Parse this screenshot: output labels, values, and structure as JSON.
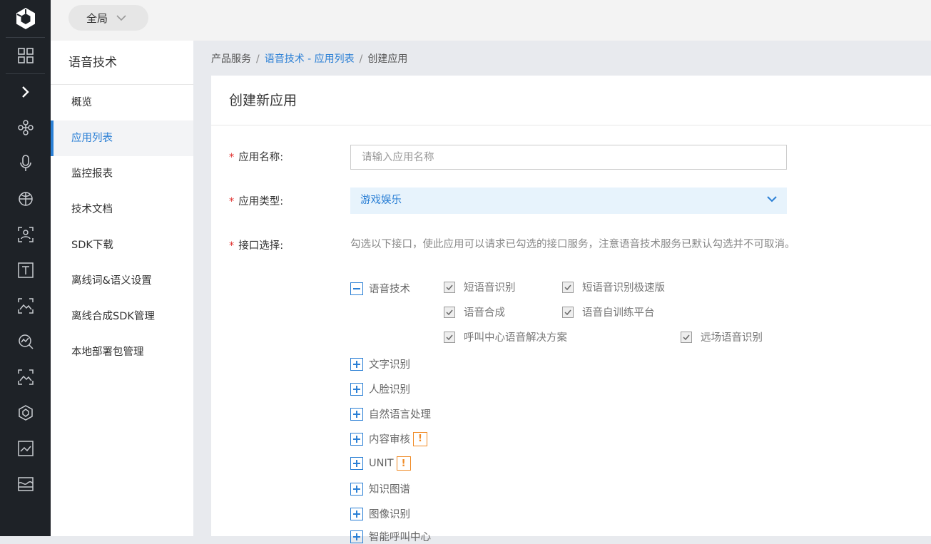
{
  "topbar": {
    "scope_label": "全局"
  },
  "rail_icons": [
    "grid-icon",
    "chevron-right-icon",
    "network-icon",
    "microphone-icon",
    "globe-icon",
    "face-scan-icon",
    "text-icon",
    "landscape-icon",
    "analytics-icon",
    "image-icon",
    "model-icon",
    "chart-icon",
    "map-icon"
  ],
  "sidebar": {
    "title": "语音技术",
    "items": [
      {
        "label": "概览"
      },
      {
        "label": "应用列表"
      },
      {
        "label": "监控报表"
      },
      {
        "label": "技术文档"
      },
      {
        "label": "SDK下载"
      },
      {
        "label": "离线词&语义设置"
      },
      {
        "label": "离线合成SDK管理"
      },
      {
        "label": "本地部署包管理"
      }
    ]
  },
  "breadcrumb": {
    "root": "产品服务",
    "sep": "/",
    "parent": "语音技术 - 应用列表",
    "current": "创建应用"
  },
  "form": {
    "title": "创建新应用",
    "required_mark": "*",
    "name_label": "应用名称:",
    "name_placeholder": "请输入应用名称",
    "type_label": "应用类型:",
    "type_value": "游戏娱乐",
    "api_label": "接口选择:",
    "api_hint": "勾选以下接口，使此应用可以请求已勾选的接口服务，注意语音技术服务已默认勾选并不可取消。",
    "expanded_group": {
      "name": "语音技术",
      "options": [
        "短语音识别",
        "短语音识别极速版",
        "语音合成",
        "语音自训练平台",
        "呼叫中心语音解决方案",
        "远场语音识别"
      ]
    },
    "collapsed_groups": [
      {
        "name": "文字识别",
        "warn": false
      },
      {
        "name": "人脸识别",
        "warn": false
      },
      {
        "name": "自然语言处理",
        "warn": false
      },
      {
        "name": "内容审核",
        "warn": true
      },
      {
        "name": "UNIT",
        "warn": true
      },
      {
        "name": "知识图谱",
        "warn": false
      },
      {
        "name": "图像识别",
        "warn": false
      },
      {
        "name": "智能呼叫中心",
        "warn": false
      }
    ],
    "warn_glyph": "!"
  },
  "colors": {
    "accent": "#2a7fd5",
    "required": "#e0312f",
    "warning": "#f08a24",
    "rail_bg": "#1e2227"
  }
}
